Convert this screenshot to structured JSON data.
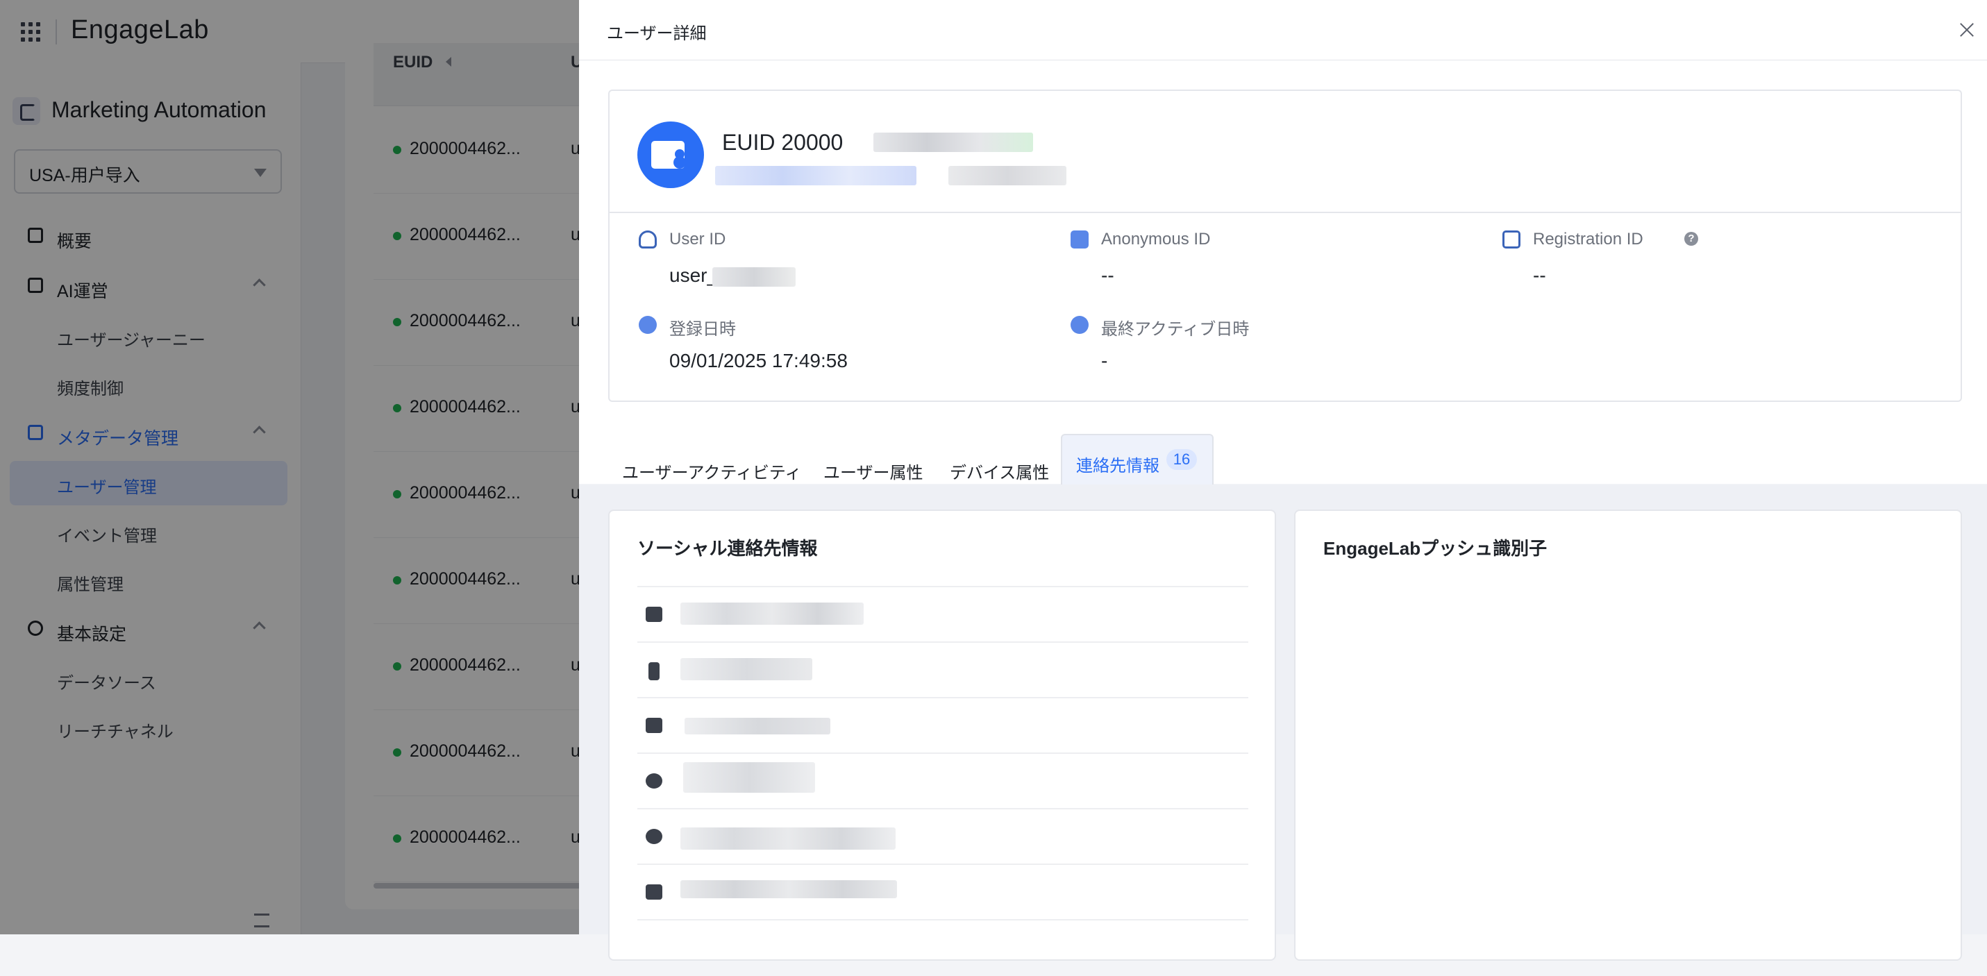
{
  "app": {
    "brand": "EngageLab",
    "module_title": "Marketing Automation",
    "project_select": "USA-用户导入"
  },
  "sidebar": {
    "items": [
      {
        "label": "概要",
        "type": "item"
      },
      {
        "label": "AI運営",
        "type": "group"
      },
      {
        "label": "ユーザージャーニー",
        "type": "sub"
      },
      {
        "label": "頻度制御",
        "type": "sub"
      },
      {
        "label": "メタデータ管理",
        "type": "group",
        "active": true
      },
      {
        "label": "ユーザー管理",
        "type": "sub",
        "active": true
      },
      {
        "label": "イベント管理",
        "type": "sub"
      },
      {
        "label": "属性管理",
        "type": "sub"
      },
      {
        "label": "基本設定",
        "type": "group"
      },
      {
        "label": "データソース",
        "type": "sub"
      },
      {
        "label": "リーチチャネル",
        "type": "sub"
      }
    ]
  },
  "table": {
    "header_euid": "EUID",
    "header_second": "U",
    "rows": [
      {
        "id": "2000004462...",
        "u": "u"
      },
      {
        "id": "2000004462...",
        "u": "u"
      },
      {
        "id": "2000004462...",
        "u": "u"
      },
      {
        "id": "2000004462...",
        "u": "u"
      },
      {
        "id": "2000004462...",
        "u": "u"
      },
      {
        "id": "2000004462...",
        "u": "u"
      },
      {
        "id": "2000004462...",
        "u": "u"
      },
      {
        "id": "2000004462...",
        "u": "u"
      },
      {
        "id": "2000004462...",
        "u": "u"
      }
    ]
  },
  "drawer": {
    "title": "ユーザー詳細",
    "euid_prefix": "EUID 20000",
    "fields": {
      "user_id_label": "User ID",
      "user_id_value": "user_",
      "anonymous_id_label": "Anonymous ID",
      "anonymous_id_value": "--",
      "registration_id_label": "Registration ID",
      "registration_id_value": "--",
      "registered_label": "登録日時",
      "registered_value": "09/01/2025 17:49:58",
      "last_active_label": "最終アクティブ日時",
      "last_active_value": "-"
    },
    "help_glyph": "?",
    "tabs": [
      {
        "label": "ユーザーアクティビティ"
      },
      {
        "label": "ユーザー属性"
      },
      {
        "label": "デバイス属性"
      },
      {
        "label": "連絡先情報",
        "count": "16",
        "active": true
      }
    ],
    "social_panel_title": "ソーシャル連絡先情報",
    "push_panel_title": "EngageLabプッシュ識別子",
    "contact_icons": [
      "mail-icon",
      "phone-icon",
      "sms-icon",
      "whatsapp-icon",
      "facebook-icon",
      "instagram-icon"
    ]
  },
  "colors": {
    "accent": "#2a6ef5",
    "online_dot": "#1fb453",
    "overlay": "rgba(0,0,0,0.45)"
  }
}
